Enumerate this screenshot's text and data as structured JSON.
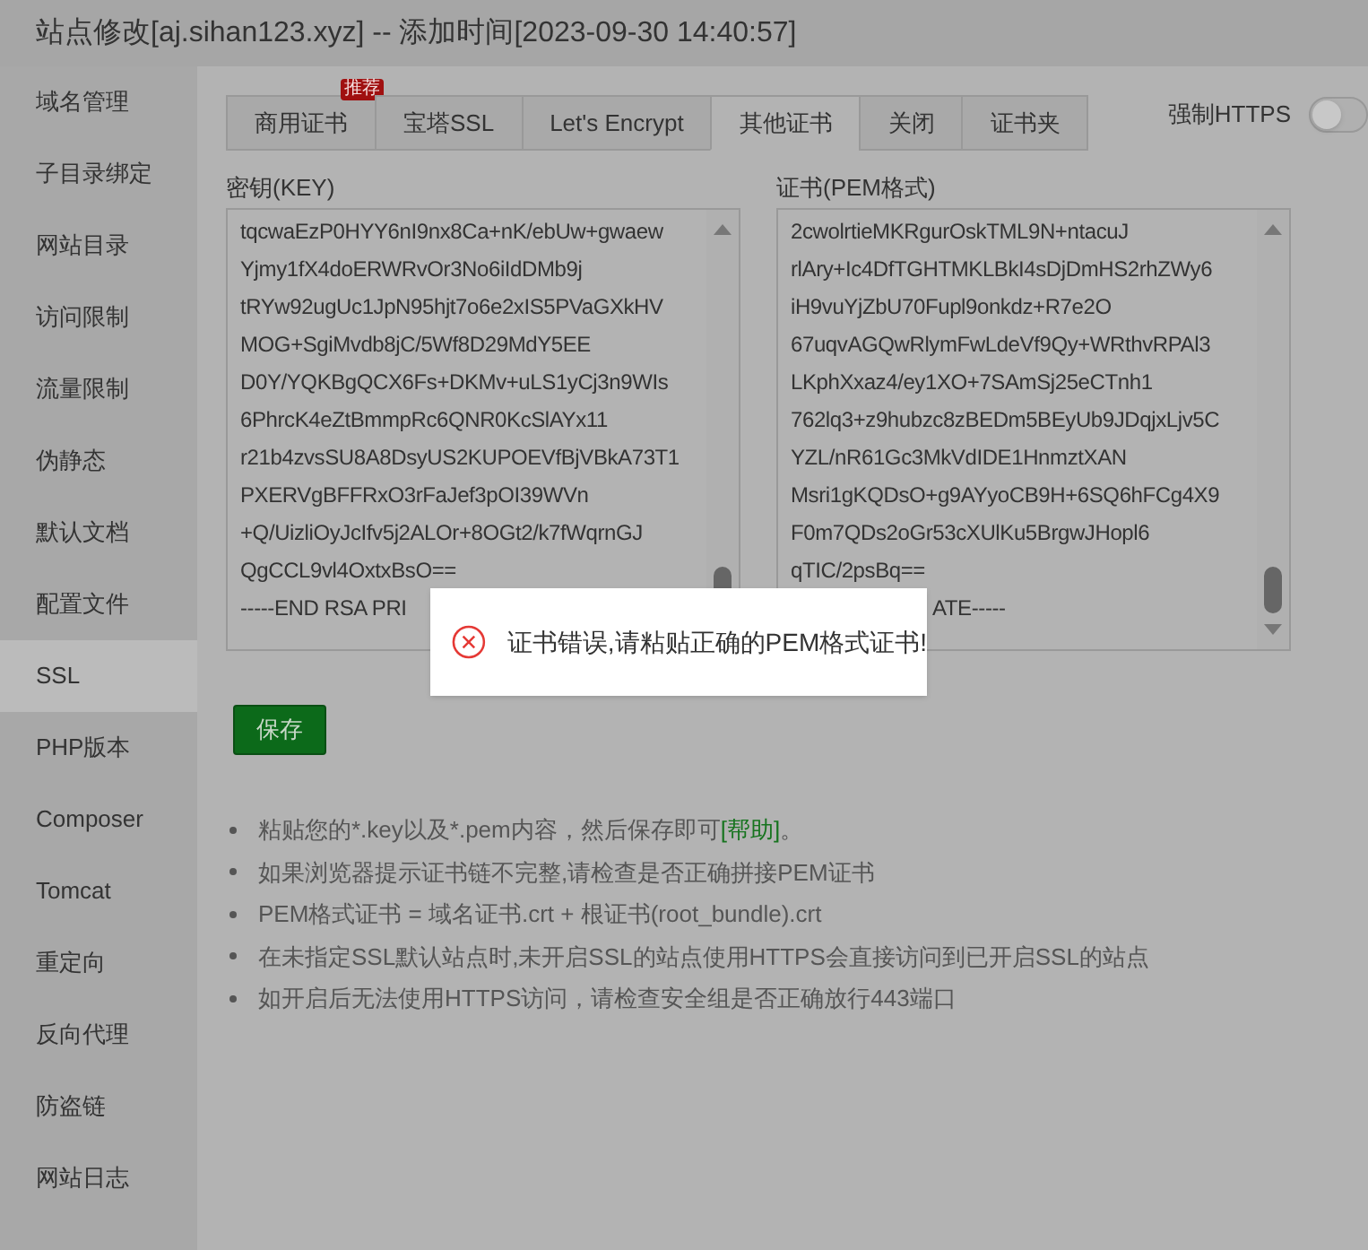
{
  "window": {
    "title": "站点修改[aj.sihan123.xyz] -- 添加时间[2023-09-30 14:40:57]"
  },
  "sidebar": {
    "items": [
      {
        "label": "域名管理",
        "selected": false
      },
      {
        "label": "子目录绑定",
        "selected": false
      },
      {
        "label": "网站目录",
        "selected": false
      },
      {
        "label": "访问限制",
        "selected": false
      },
      {
        "label": "流量限制",
        "selected": false
      },
      {
        "label": "伪静态",
        "selected": false
      },
      {
        "label": "默认文档",
        "selected": false
      },
      {
        "label": "配置文件",
        "selected": false
      },
      {
        "label": "SSL",
        "selected": true
      },
      {
        "label": "PHP版本",
        "selected": false
      },
      {
        "label": "Composer",
        "selected": false
      },
      {
        "label": "Tomcat",
        "selected": false
      },
      {
        "label": "重定向",
        "selected": false
      },
      {
        "label": "反向代理",
        "selected": false
      },
      {
        "label": "防盗链",
        "selected": false
      },
      {
        "label": "网站日志",
        "selected": false
      }
    ]
  },
  "tabs": [
    {
      "label": "商用证书",
      "selected": false,
      "badge": "推荐"
    },
    {
      "label": "宝塔SSL",
      "selected": false
    },
    {
      "label": "Let's Encrypt",
      "selected": false
    },
    {
      "label": "其他证书",
      "selected": true
    },
    {
      "label": "关闭",
      "selected": false
    },
    {
      "label": "证书夹",
      "selected": false
    }
  ],
  "force_https": {
    "label": "强制HTTPS",
    "on": false
  },
  "key_field": {
    "label": "密钥(KEY)",
    "lines": [
      {
        "text": "tqcwaEzP0HYY6nI9nx8Ca+nK/ebUw+gwaew"
      },
      {
        "text": "Yjmy1fX4doERWRvOr3No6iIdDMb9j"
      },
      {
        "text": "tRYw92ugUc1JpN95hjt7o6e2xIS5PVaGXkHV"
      },
      {
        "text": "MOG+SgiMvdb8jC/5Wf8D29MdY5EE"
      },
      {
        "text": "D0Y/YQKBgQCX6Fs+DKMv+uLS1yCj3n9WIs"
      },
      {
        "text": "6PhrcK4eZtBmmpRc6QNR0KcSlAYx11"
      },
      {
        "text": "r21b4zvsSU8A8DsyUS2KUPOEVfBjVBkA73T1"
      },
      {
        "text": "PXERVgBFFRxO3rFaJef3pOI39WVn"
      },
      {
        "text": "+Q/UizliOyJcIfv5j2ALOr+8OGt2/k7fWqrnGJ"
      },
      {
        "text": "QgCCL9vl4OxtxBsO=="
      },
      {
        "text": "-----END RSA PRI"
      }
    ]
  },
  "cert_field": {
    "label": "证书(PEM格式)",
    "lines": [
      {
        "text": "2cwolrtieMKRgurOskTML9N+ntacuJ"
      },
      {
        "text": "rlAry+Ic4DfTGHTMKLBkI4sDjDmHS2rhZWy6"
      },
      {
        "text": "iH9vuYjZbU70Fupl9onkdz+R7e2O"
      },
      {
        "text": "67uqvAGQwRlymFwLdeVf9Qy+WRthvRPAl3"
      },
      {
        "text": "LKphXxaz4/ey1XO+7SAmSj25eCTnh1"
      },
      {
        "text": "762lq3+z9hubzc8zBEDm5BEyUb9JDqjxLjv5C"
      },
      {
        "text": "YZL/nR61Gc3MkVdIDE1HnmztXAN"
      },
      {
        "text": "Msri1gKQDsO+g9AYyoCB9H+6SQ6hFCg4X9"
      },
      {
        "text": "F0m7QDs2oGr53cXUlKu5BrgwJHopl6"
      },
      {
        "text": "qTIC/2psBq=="
      },
      {
        "text": "ATE-----",
        "kind": "tail"
      }
    ]
  },
  "save_button": "保存",
  "notes": [
    {
      "text": "粘贴您的*.key以及*.pem内容，然后保存即可",
      "link": "[帮助]",
      "end": "。"
    },
    {
      "text": "如果浏览器提示证书链不完整,请检查是否正确拼接PEM证书"
    },
    {
      "text": "PEM格式证书 = 域名证书.crt + 根证书(root_bundle).crt"
    },
    {
      "text": "在未指定SSL默认站点时,未开启SSL的站点使用HTTPS会直接访问到已开启SSL的站点"
    },
    {
      "text": "如开启后无法使用HTTPS访问，请检查安全组是否正确放行443端口"
    }
  ],
  "toast": {
    "message": "证书错误,请粘贴正确的PEM格式证书!"
  }
}
